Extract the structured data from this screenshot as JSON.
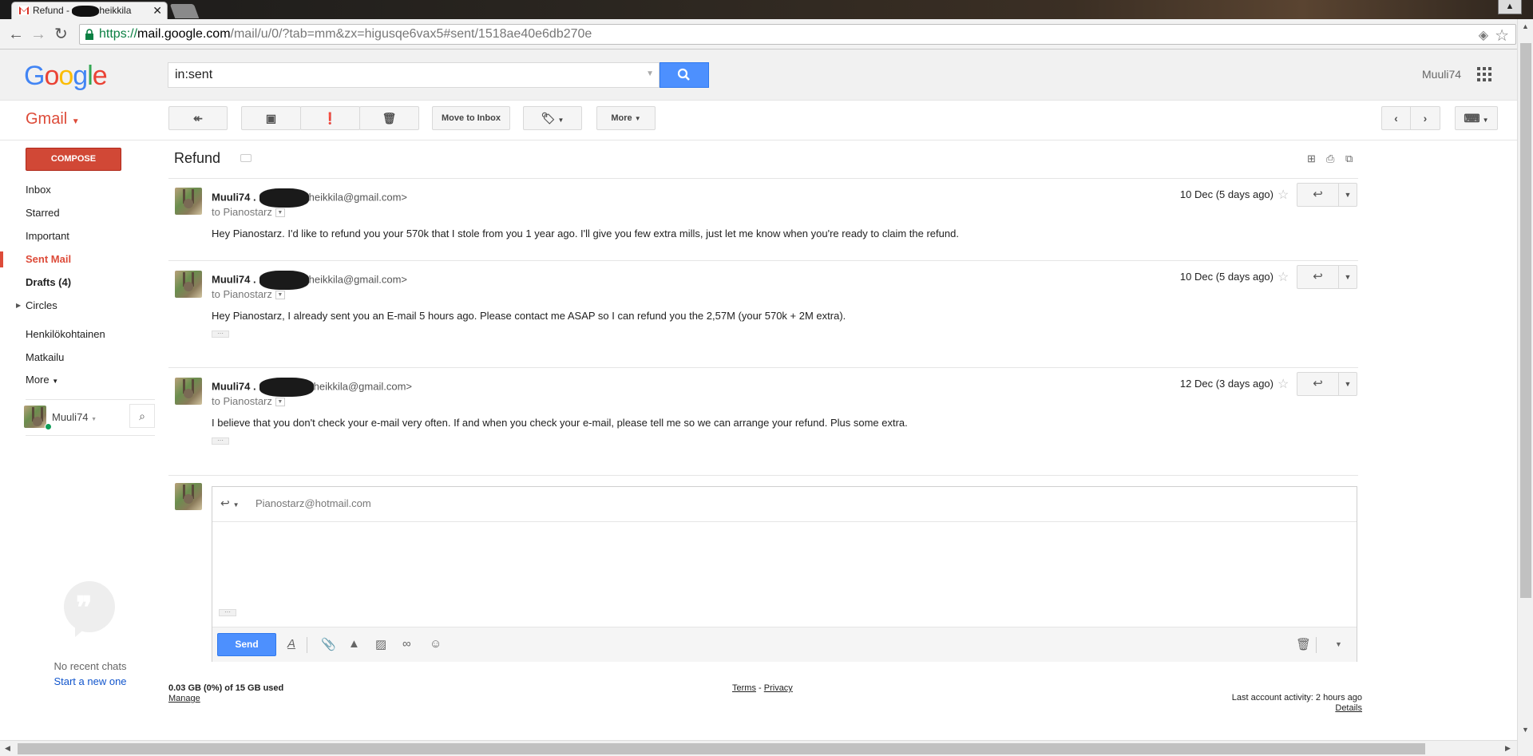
{
  "browser": {
    "tab_title": "Refund - ",
    "tab_title_tail": "heikkila",
    "url_scheme": "https://",
    "url_host": "mail.google.com",
    "url_path": "/mail/u/0/?tab=mm&zx=higusqe6vax5#sent/1518ae40e6db270e"
  },
  "header": {
    "logo": [
      "G",
      "o",
      "o",
      "g",
      "l",
      "e"
    ],
    "logo_colors": [
      "#4285f4",
      "#ea4335",
      "#fbbc05",
      "#4285f4",
      "#34a853",
      "#ea4335"
    ],
    "search_value": "in:sent",
    "username": "Muuli74"
  },
  "actionbar": {
    "gmail_label": "Gmail",
    "move_to_inbox": "Move to Inbox",
    "more": "More"
  },
  "sidebar": {
    "compose": "COMPOSE",
    "items": [
      {
        "label": "Inbox"
      },
      {
        "label": "Starred"
      },
      {
        "label": "Important"
      },
      {
        "label": "Sent Mail"
      },
      {
        "label": "Drafts (4)"
      },
      {
        "label": "Circles"
      },
      {
        "label": "Henkilökohtainen"
      },
      {
        "label": "Matkailu"
      },
      {
        "label": "More"
      }
    ],
    "hangout_user": "Muuli74"
  },
  "conversation": {
    "subject": "Refund",
    "messages": [
      {
        "sender": "Muuli74 .",
        "email_tail": "heikkila@gmail.com>",
        "to": "to Pianostarz",
        "date": "10 Dec (5 days ago)",
        "body": "Hey Pianostarz. I'd like to refund you your 570k that I stole from you 1 year ago. I'll give you few extra mills, just let me know when you're ready to claim the refund."
      },
      {
        "sender": "Muuli74 .",
        "email_tail": "heikkila@gmail.com>",
        "to": "to Pianostarz",
        "date": "10 Dec (5 days ago)",
        "body": "Hey Pianostarz, I already sent you an E-mail 5 hours ago. Please contact me ASAP so I can refund you the 2,57M (your 570k + 2M extra)."
      },
      {
        "sender": "Muuli74 .",
        "email_tail": "heikkila@gmail.com>",
        "to": "to Pianostarz",
        "date": "12 Dec (3 days ago)",
        "body": "I believe that you don't check your e-mail very often. If and when you check your e-mail, please tell me so we can arrange your refund. Plus some extra."
      }
    ],
    "reply_to": "Pianostarz@hotmail.com",
    "send": "Send"
  },
  "chats": {
    "no_recent": "No recent chats",
    "start_new": "Start a new one"
  },
  "footer": {
    "storage": "0.03 GB (0%) of 15 GB used",
    "manage": "Manage",
    "terms": "Terms",
    "dash": "-",
    "privacy": "Privacy",
    "activity": "Last account activity: 2 hours ago",
    "details": "Details"
  },
  "colors": {
    "gmail_red": "#dd4b39",
    "search_blue": "#4d90fe",
    "compose_red": "#d14836"
  }
}
